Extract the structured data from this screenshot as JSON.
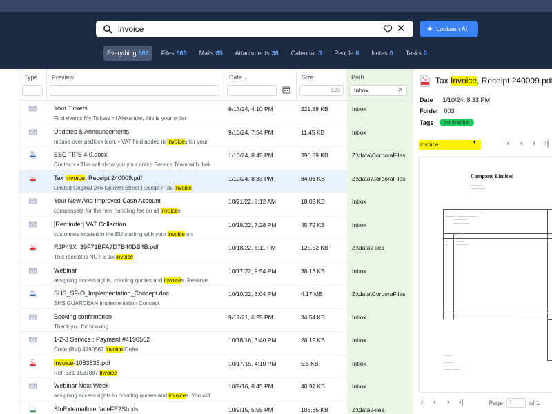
{
  "search": {
    "query": "invoice"
  },
  "ai_button": {
    "label": "Lookeen AI"
  },
  "tabs": [
    {
      "label": "Everything",
      "count": "686",
      "active": true
    },
    {
      "label": "Files",
      "count": "565"
    },
    {
      "label": "Mails",
      "count": "85"
    },
    {
      "label": "Attachments",
      "count": "36"
    },
    {
      "label": "Calendar",
      "count": "0"
    },
    {
      "label": "People",
      "count": "0"
    },
    {
      "label": "Notes",
      "count": "0"
    },
    {
      "label": "Tasks",
      "count": "0"
    }
  ],
  "columns": {
    "type": "Type",
    "preview": "Preview",
    "date": "Date",
    "size": "Size",
    "size_filter": "123",
    "path": "Path",
    "path_filter": "Inbox"
  },
  "rows": [
    {
      "icon": "mail",
      "title": "Your Tickets",
      "snippet": "Find events My Tickets Hi Alexander, this is your order",
      "date": "9/17/24, 4:10 PM",
      "size": "221.88 KB",
      "path": "Inbox"
    },
    {
      "icon": "mail",
      "title": "Updates & Announcements",
      "snippet": "mouse over padlock icon. • VAT field added in Invoices for your",
      "date": "9/10/24, 7:54 PM",
      "size": "11.45 KB",
      "path": "Inbox"
    },
    {
      "icon": "docx",
      "title": "ESC TIPS 4 0.docx",
      "snippet": "Contacts • This will show you your entire Service Team with their",
      "date": "1/10/24, 8:45 PM",
      "size": "390.89 KB",
      "path": "Z:\\data\\CorporaFiles"
    },
    {
      "icon": "pdf",
      "title": "Tax Invoice, Receipt 240009.pdf",
      "snippet": "Limited Original 246 Uptown Street Receipt / Tax Invoice",
      "date": "1/10/24, 8:33 PM",
      "size": "84.01 KB",
      "path": "Z:\\data\\CorporaFiles",
      "selected": true
    },
    {
      "icon": "mail",
      "title": "Your New And Improved Cash Account",
      "snippet": "compensate for the new handling fee on all invoices",
      "date": "10/21/22, 8:12 AM",
      "size": "18.03 KB",
      "path": "Inbox"
    },
    {
      "icon": "mail",
      "title": "[Reminder] VAT Collection",
      "snippet": "customers located in the EU starting with your invoice on",
      "date": "10/18/22, 7:28 PM",
      "size": "45.72 KB",
      "path": "Inbox"
    },
    {
      "icon": "pdf",
      "title": "RJP49X_39F71BFA7D7B40DB4B.pdf",
      "snippet": "This receipt is NOT a tax invoice",
      "date": "10/18/22, 6:11 PM",
      "size": "125.52 KB",
      "path": "Z:\\data\\Files"
    },
    {
      "icon": "mail",
      "title": "Webinar",
      "snippet": "assigning access rights, creating quotes and invoices. Reserve",
      "date": "10/17/22, 9:54 PM",
      "size": "38.13 KB",
      "path": "Inbox"
    },
    {
      "icon": "doc",
      "title": "SHS_SF-O_Implementation_Concept.doc",
      "snippet": "SHS GUARDEAN Implementation Concept",
      "date": "10/10/22, 6:04 PM",
      "size": "4.17 MB",
      "path": "Z:\\data\\CorporaFiles"
    },
    {
      "icon": "mail",
      "title": "Booking confirmation",
      "snippet": "Thank you for booking",
      "date": "9/17/21, 6:25 PM",
      "size": "34.54 KB",
      "path": "Inbox"
    },
    {
      "icon": "mail",
      "title": "1-2-3 Service : Payment #4190562",
      "snippet": "Code (Ref) 4190562 Invoice/Order",
      "date": "10/18/16, 3:40 PM",
      "size": "28.19 KB",
      "path": "Inbox"
    },
    {
      "icon": "pdf",
      "title": "Invoice-1083638.pdf",
      "snippet": "Ref: 321-1537087 Invoice",
      "date": "10/17/15, 4:10 PM",
      "size": "5.5 KB",
      "path": "Inbox"
    },
    {
      "icon": "mail",
      "title": "Webinar Next Week",
      "snippet": "assigning access rights to creating quotes and invoices. You will",
      "date": "10/9/16, 8:45 PM",
      "size": "40.97 KB",
      "path": "Inbox"
    },
    {
      "icon": "xls",
      "title": "SfoExternalInterfaceFE2Sb.xls",
      "snippet": "",
      "date": "10/9/15, 5:55 PM",
      "size": "106.65 KB",
      "path": "Z:\\data\\Files"
    }
  ],
  "preview": {
    "title": "Tax Invoice, Receipt 240009.pdf",
    "date_label": "Date",
    "date": "1/10/24, 8:33 PM",
    "folder_label": "Folder",
    "folder": "003",
    "tags_label": "Tags",
    "tag": "contractor",
    "find_value": "invoice",
    "doc_company": "Company Limited",
    "page_label": "Page",
    "page_value": "1",
    "page_of": "of 1"
  },
  "colors": {
    "header": "#1c2a44",
    "highlight": "#fff200",
    "path_bg": "#eaf5e4",
    "accent": "#3b82f6",
    "tag": "#22c55e"
  }
}
